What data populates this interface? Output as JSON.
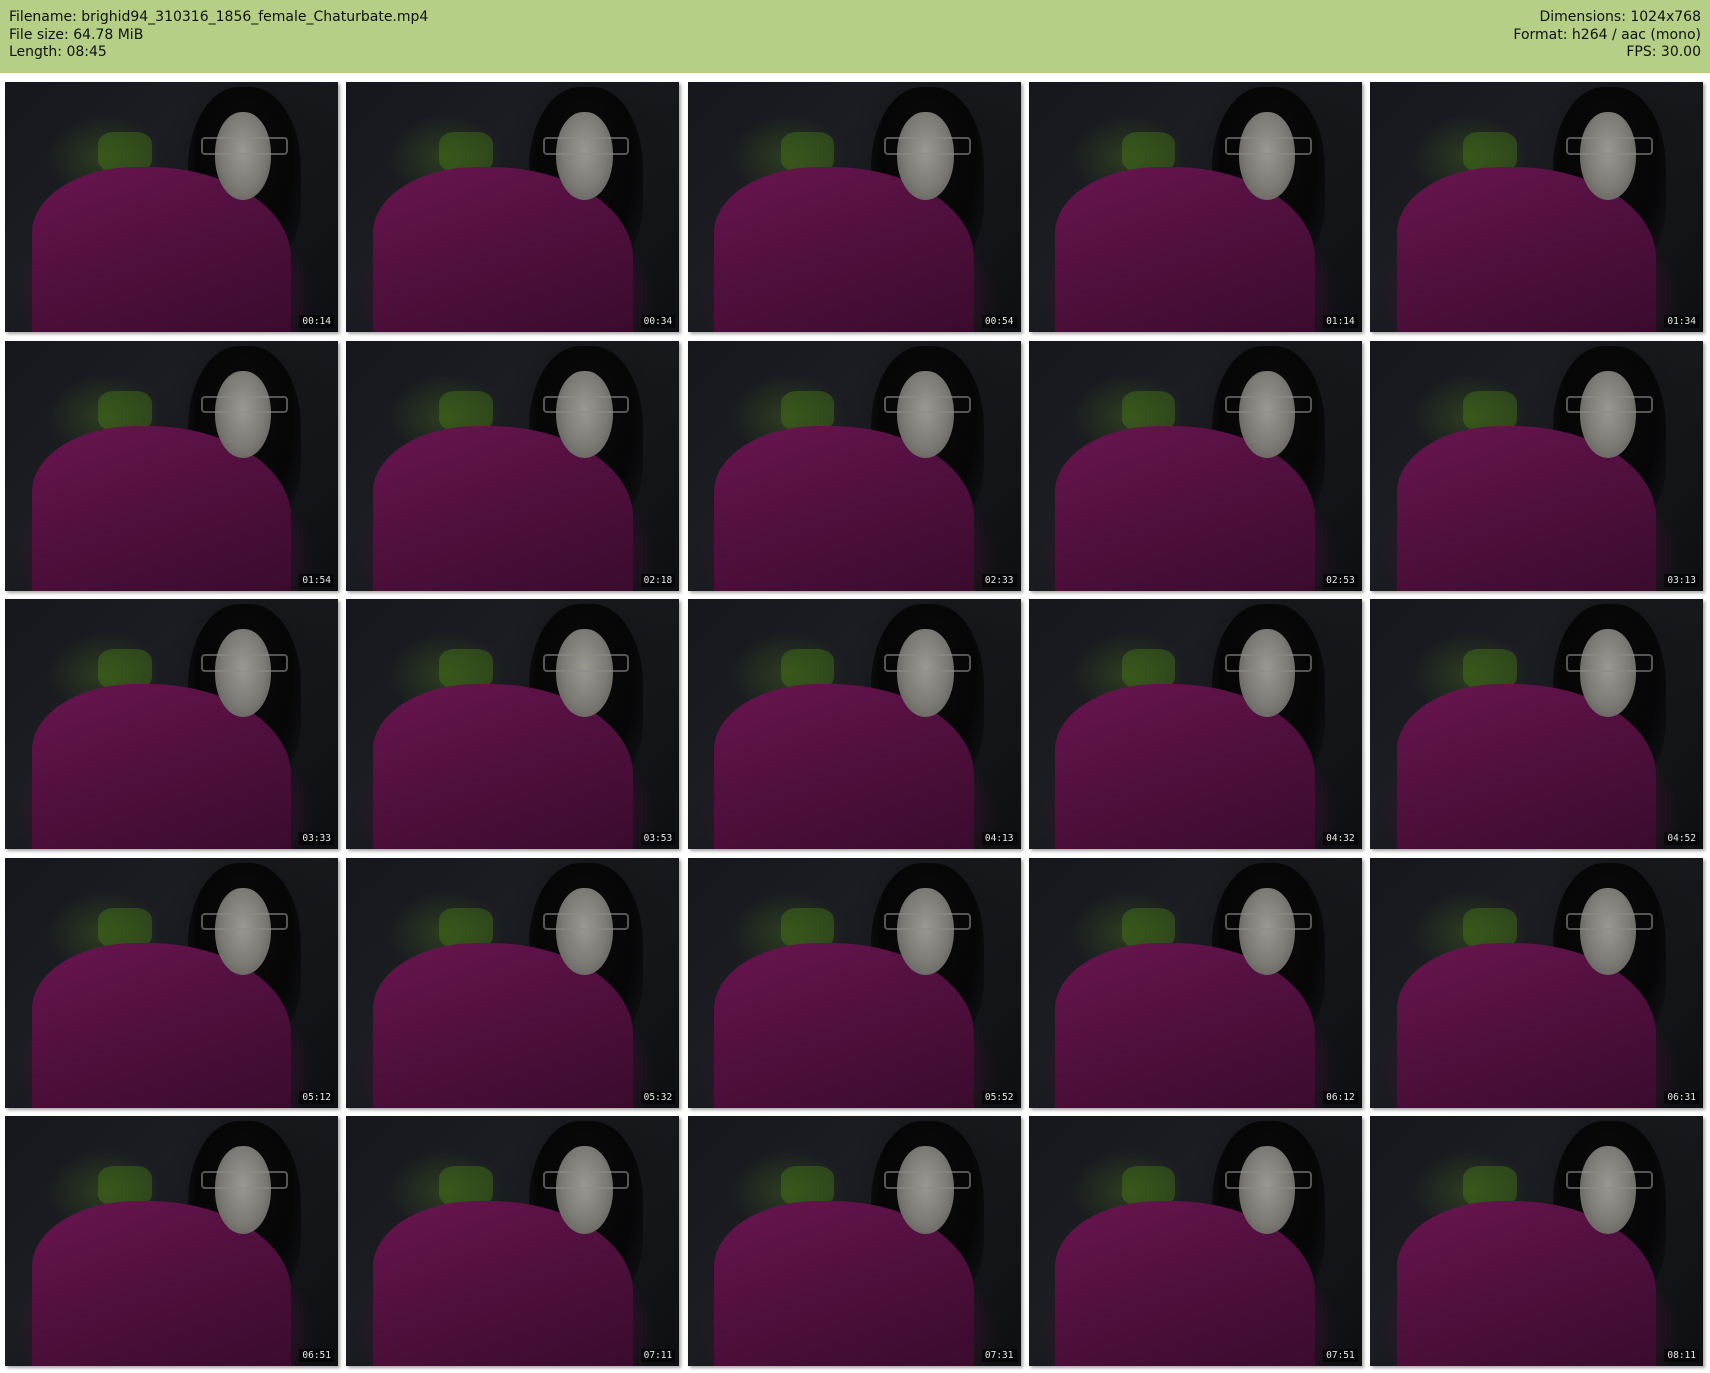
{
  "header": {
    "filename": "Filename: brighid94_310316_1856_female_Chaturbate.mp4",
    "filesize": "File size: 64.78 MiB",
    "length": "Length: 08:45",
    "dimensions": "Dimensions: 1024x768",
    "format": "Format: h264 / aac (mono)",
    "fps": "FPS: 30.00"
  },
  "colors": {
    "header_background": "#b5cf86",
    "page_background": "#ffffff"
  },
  "thumbnails": [
    {
      "time": "00:14"
    },
    {
      "time": "00:34"
    },
    {
      "time": "00:54"
    },
    {
      "time": "01:14"
    },
    {
      "time": "01:34"
    },
    {
      "time": "01:54"
    },
    {
      "time": "02:18"
    },
    {
      "time": "02:33"
    },
    {
      "time": "02:53"
    },
    {
      "time": "03:13"
    },
    {
      "time": "03:33"
    },
    {
      "time": "03:53"
    },
    {
      "time": "04:13"
    },
    {
      "time": "04:32"
    },
    {
      "time": "04:52"
    },
    {
      "time": "05:12"
    },
    {
      "time": "05:32"
    },
    {
      "time": "05:52"
    },
    {
      "time": "06:12"
    },
    {
      "time": "06:31"
    },
    {
      "time": "06:51"
    },
    {
      "time": "07:11"
    },
    {
      "time": "07:31"
    },
    {
      "time": "07:51"
    },
    {
      "time": "08:11"
    }
  ]
}
